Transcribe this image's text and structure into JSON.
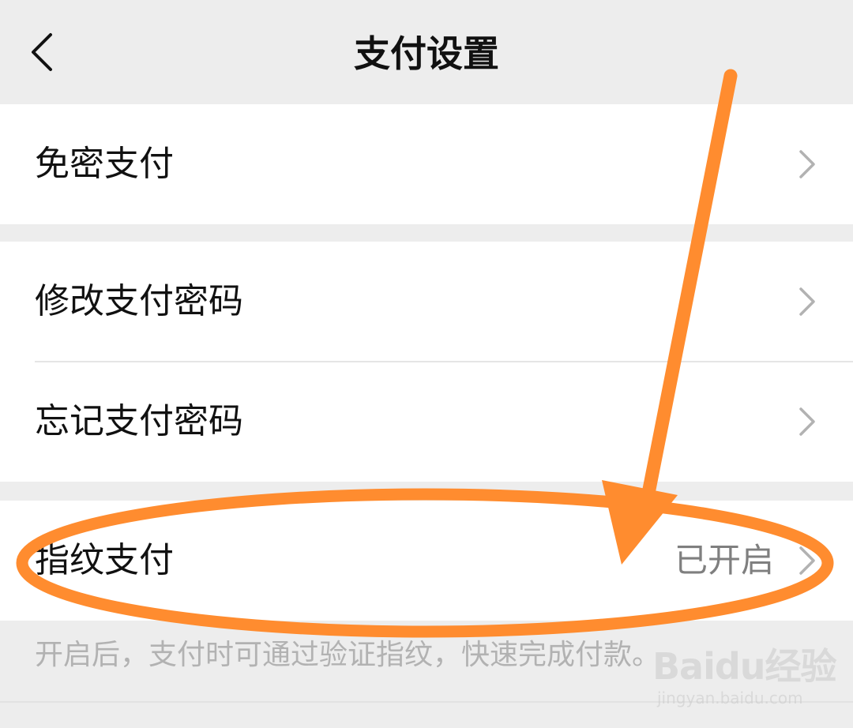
{
  "header": {
    "title": "支付设置",
    "back_icon": "chevron-left-icon"
  },
  "groups": [
    {
      "items": [
        {
          "label": "免密支付",
          "icon": "chevron-right-icon"
        }
      ]
    },
    {
      "items": [
        {
          "label": "修改支付密码",
          "icon": "chevron-right-icon"
        },
        {
          "label": "忘记支付密码",
          "icon": "chevron-right-icon"
        }
      ]
    },
    {
      "items": [
        {
          "label": "指纹支付",
          "value": "已开启",
          "icon": "chevron-right-icon"
        }
      ]
    }
  ],
  "footnote": "开启后，支付时可通过验证指纹，快速完成付款。",
  "watermark": {
    "logo": "Baidu经验",
    "url": "jingyan.baidu.com"
  },
  "annotation": {
    "color": "#ff8c2f"
  }
}
